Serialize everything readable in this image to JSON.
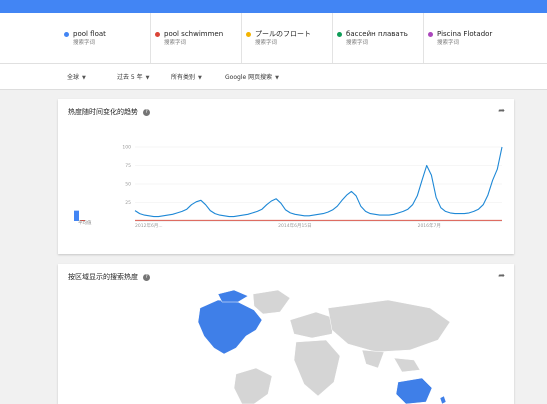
{
  "colors": {
    "top_bar": "#4285f4",
    "series_pool_float": "#4285f4",
    "series_pool_schwimmen": "#db4437",
    "series_japanese": "#f4b400",
    "series_russian": "#0f9d58",
    "series_portuguese": "#ab47bc",
    "line": "#1e88d6",
    "map_highlight": "#3f7fe8",
    "map_base": "#d5d5d5"
  },
  "terms": [
    {
      "name": "pool float",
      "sub": "搜索字词",
      "color": "#4285f4"
    },
    {
      "name": "pool schwimmen",
      "sub": "搜索字词",
      "color": "#db4437"
    },
    {
      "name": "プールのフロート",
      "sub": "搜索字词",
      "color": "#f4b400"
    },
    {
      "name": "бассейн плавать",
      "sub": "搜索字词",
      "color": "#0f9d58"
    },
    {
      "name": "Piscina Flotador",
      "sub": "搜索字词",
      "color": "#ab47bc"
    }
  ],
  "filters": {
    "region": "全球",
    "time": "过去 5 年",
    "category": "所有类别",
    "property": "Google 网页搜索"
  },
  "trend_card": {
    "title": "热度随时间变化的趋势",
    "avg_label": "平均值",
    "share_icon": "share-icon",
    "help_icon": "help-icon"
  },
  "region_card": {
    "title": "按区域显示的搜索热度",
    "share_icon": "share-icon",
    "help_icon": "help-icon"
  },
  "chart_data": {
    "type": "line",
    "ylim": [
      0,
      100
    ],
    "yticks": [
      "100",
      "75",
      "50",
      "25"
    ],
    "xticks": [
      "2012年6月...",
      "2014年6月15日",
      "2016年7月"
    ],
    "averages": [
      {
        "name": "pool float",
        "value": 14
      },
      {
        "name": "pool schwimmen",
        "value": 1
      },
      {
        "name": "プールのフロート",
        "value": 0
      },
      {
        "name": "бассейн плавать",
        "value": 0
      },
      {
        "name": "Piscina Flotador",
        "value": 0
      }
    ],
    "series": [
      {
        "name": "pool float",
        "values": [
          14,
          10,
          8,
          7,
          6,
          6,
          7,
          8,
          9,
          11,
          13,
          16,
          22,
          26,
          28,
          22,
          14,
          10,
          8,
          7,
          6,
          6,
          7,
          8,
          9,
          11,
          13,
          16,
          22,
          27,
          30,
          24,
          15,
          11,
          9,
          8,
          7,
          7,
          8,
          9,
          10,
          12,
          15,
          20,
          28,
          35,
          40,
          34,
          20,
          13,
          10,
          9,
          8,
          8,
          8,
          9,
          11,
          13,
          16,
          22,
          34,
          55,
          75,
          62,
          32,
          18,
          13,
          11,
          10,
          10,
          10,
          11,
          13,
          16,
          22,
          35,
          55,
          70,
          100
        ]
      },
      {
        "name": "pool schwimmen",
        "values": [
          1,
          1,
          1,
          1,
          1,
          1,
          1,
          1,
          1,
          1,
          1,
          1,
          1,
          1,
          1,
          1,
          1,
          1,
          1,
          1,
          1,
          1,
          1,
          1,
          1,
          1,
          1,
          1,
          1,
          1,
          1,
          1,
          1,
          1,
          1,
          1,
          1,
          1,
          1,
          1,
          1,
          1,
          1,
          1,
          1,
          1,
          1,
          1,
          1,
          1,
          1,
          1,
          1,
          1,
          1,
          1,
          1,
          1,
          1,
          1,
          1,
          1,
          1,
          1,
          1,
          1,
          1,
          1,
          1,
          1,
          1,
          1,
          1,
          1,
          1,
          1,
          1,
          1,
          1
        ]
      }
    ]
  }
}
